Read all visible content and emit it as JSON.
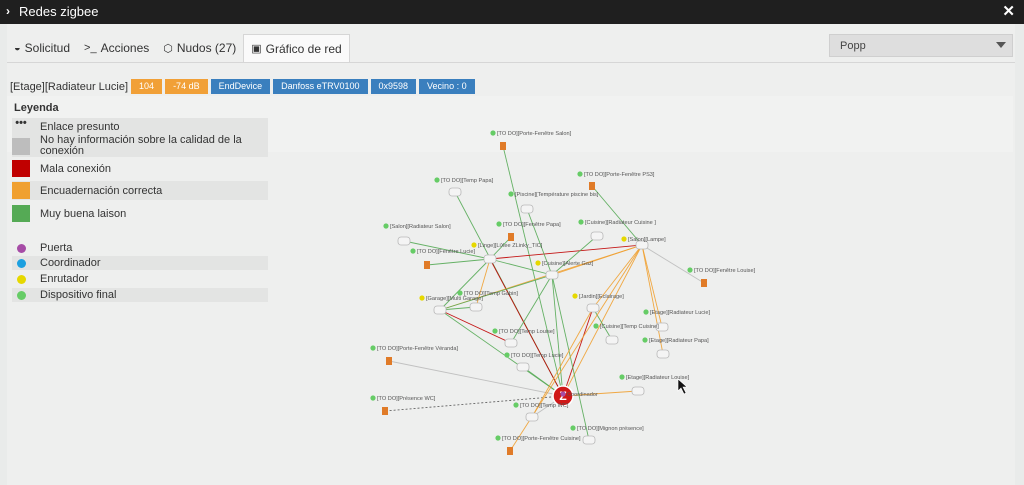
{
  "window": {
    "title": "Redes zigbee"
  },
  "tabs": [
    {
      "label": "Solicitud",
      "icon": "gauge-icon"
    },
    {
      "label": "Acciones",
      "icon": "terminal-icon"
    },
    {
      "label": "Nudos (27)",
      "icon": "cube-icon"
    },
    {
      "label": "Gráfico de red",
      "icon": "image-icon"
    }
  ],
  "select": {
    "value": "Popp"
  },
  "selected_node": {
    "name": "[Etage][Radiateur Lucie]",
    "badges": [
      "104",
      "-74 dB",
      "EndDevice",
      "Danfoss eTRV0100",
      "0x9598",
      "Vecino : 0"
    ]
  },
  "legend": {
    "title": "Leyenda",
    "links": [
      {
        "label": "Enlace presunto",
        "color": "#444444"
      },
      {
        "label": "No hay información sobre la calidad de la conexión",
        "color": "#bdbdbd"
      },
      {
        "label": "Mala conexión",
        "color": "#c00000"
      },
      {
        "label": "Encuadernación correcta",
        "color": "#f0a030"
      },
      {
        "label": "Muy buena laison",
        "color": "#55aa55"
      }
    ],
    "nodes": [
      {
        "label": "Puerta",
        "color": "#a64ca6"
      },
      {
        "label": "Coordinador",
        "color": "#1ca0e0"
      },
      {
        "label": "Enrutador",
        "color": "#e6d800"
      },
      {
        "label": "Dispositivo final",
        "color": "#66cc66"
      }
    ]
  },
  "graph": {
    "nodes": [
      {
        "id": "coord",
        "label": "Coordinador",
        "color": "#a64ca6"
      },
      {
        "id": "n1",
        "label": "[TO DO][Porte-Fenêtre Salon]",
        "color": "#66cc66"
      },
      {
        "id": "n2",
        "label": "[TO DO][Porte-Fenêtre PS3]",
        "color": "#66cc66"
      },
      {
        "id": "n3",
        "label": "[TO DO][Temp Papa]",
        "color": "#66cc66"
      },
      {
        "id": "n4",
        "label": "[Piscine][Température piscine bis]",
        "color": "#66cc66"
      },
      {
        "id": "n5",
        "label": "[TO DO][Fenêtre Papa]",
        "color": "#66cc66"
      },
      {
        "id": "n6",
        "label": "[Cuisine][Radiateur Cuisine ]",
        "color": "#66cc66"
      },
      {
        "id": "n7",
        "label": "[Salon][Radiateur Salon]",
        "color": "#66cc66"
      },
      {
        "id": "n8",
        "label": "[Linge][LiXee ZLinky_TIC]",
        "color": "#e6d800"
      },
      {
        "id": "n9",
        "label": "[Salon][Lampe]",
        "color": "#e6d800"
      },
      {
        "id": "n10",
        "label": "[TO DO][Fenêtre Lucie]",
        "color": "#66cc66"
      },
      {
        "id": "n11",
        "label": "[Cuisine][Alerte Gaz]",
        "color": "#e6d800"
      },
      {
        "id": "n12",
        "label": "[TO DO][Fenêtre Louise]",
        "color": "#66cc66"
      },
      {
        "id": "n13",
        "label": "[Garage][Multi Garage]",
        "color": "#e6d800"
      },
      {
        "id": "n14",
        "label": "[TO DO][Temp Gabin]",
        "color": "#66cc66"
      },
      {
        "id": "n15",
        "label": "[Jardin][Eclairage]",
        "color": "#e6d800"
      },
      {
        "id": "n16",
        "label": "[Etage][Radiateur Lucie]",
        "color": "#66cc66"
      },
      {
        "id": "n17",
        "label": "[Cuisine][Temp Cuisine]",
        "color": "#66cc66"
      },
      {
        "id": "n18",
        "label": "[TO DO][Temp Louise]",
        "color": "#66cc66"
      },
      {
        "id": "n19",
        "label": "[Etage][Radiateur Papa]",
        "color": "#66cc66"
      },
      {
        "id": "n20",
        "label": "[TO DO][Porte-Fenêtre Véranda]",
        "color": "#66cc66"
      },
      {
        "id": "n21",
        "label": "[TO DO][Temp Lucie]",
        "color": "#66cc66"
      },
      {
        "id": "n22",
        "label": "[Etage][Radiateur Louise]",
        "color": "#66cc66"
      },
      {
        "id": "n23",
        "label": "[TO DO][Présence WC]",
        "color": "#66cc66"
      },
      {
        "id": "n24",
        "label": "[TO DO][Temp WC]",
        "color": "#66cc66"
      },
      {
        "id": "n25",
        "label": "[TO DO][Mignon présence]",
        "color": "#66cc66"
      },
      {
        "id": "n26",
        "label": "[TO DO][Porte-Fenêtre Cuisine]",
        "color": "#66cc66"
      }
    ],
    "links": [
      {
        "from": "coord",
        "to": "n1",
        "quality": "good"
      },
      {
        "from": "coord",
        "to": "n3",
        "quality": "good"
      },
      {
        "from": "coord",
        "to": "n11",
        "quality": "good"
      },
      {
        "from": "coord",
        "to": "n13",
        "quality": "good"
      },
      {
        "from": "coord",
        "to": "n8",
        "quality": "bad"
      },
      {
        "from": "coord",
        "to": "n9",
        "quality": "correct"
      },
      {
        "from": "coord",
        "to": "n15",
        "quality": "bad"
      },
      {
        "from": "coord",
        "to": "n21",
        "quality": "good"
      },
      {
        "from": "coord",
        "to": "n23",
        "quality": "presumed"
      },
      {
        "from": "coord",
        "to": "n24",
        "quality": "unknown"
      },
      {
        "from": "coord",
        "to": "n22",
        "quality": "correct"
      },
      {
        "from": "coord",
        "to": "n20",
        "quality": "unknown"
      },
      {
        "from": "n8",
        "to": "n9",
        "quality": "bad"
      },
      {
        "from": "n8",
        "to": "n13",
        "quality": "good"
      },
      {
        "from": "n8",
        "to": "n11",
        "quality": "good"
      },
      {
        "from": "n8",
        "to": "n5",
        "quality": "good"
      },
      {
        "from": "n8",
        "to": "n7",
        "quality": "good"
      },
      {
        "from": "n8",
        "to": "n10",
        "quality": "good"
      },
      {
        "from": "n8",
        "to": "n14",
        "quality": "correct"
      },
      {
        "from": "n9",
        "to": "n11",
        "quality": "correct"
      },
      {
        "from": "n9",
        "to": "n13",
        "quality": "correct"
      },
      {
        "from": "n9",
        "to": "n15",
        "quality": "correct"
      },
      {
        "from": "n9",
        "to": "n16",
        "quality": "correct"
      },
      {
        "from": "n9",
        "to": "n19",
        "quality": "correct"
      },
      {
        "from": "n9",
        "to": "n2",
        "quality": "good"
      },
      {
        "from": "n9",
        "to": "n12",
        "quality": "unknown"
      },
      {
        "from": "n11",
        "to": "n13",
        "quality": "good"
      },
      {
        "from": "n11",
        "to": "n4",
        "quality": "good"
      },
      {
        "from": "n11",
        "to": "n18",
        "quality": "good"
      },
      {
        "from": "n11",
        "to": "n25",
        "quality": "good"
      },
      {
        "from": "n11",
        "to": "n6",
        "quality": "good"
      },
      {
        "from": "n15",
        "to": "n17",
        "quality": "good"
      },
      {
        "from": "n15",
        "to": "n24",
        "quality": "correct"
      },
      {
        "from": "n13",
        "to": "n14",
        "quality": "good"
      },
      {
        "from": "n13",
        "to": "n18",
        "quality": "bad"
      },
      {
        "from": "n9",
        "to": "n26",
        "quality": "correct"
      }
    ]
  },
  "link_colors": {
    "presumed": "#555555",
    "unknown": "#bbbbbb",
    "bad": "#c00000",
    "correct": "#f0a030",
    "good": "#55aa55"
  }
}
